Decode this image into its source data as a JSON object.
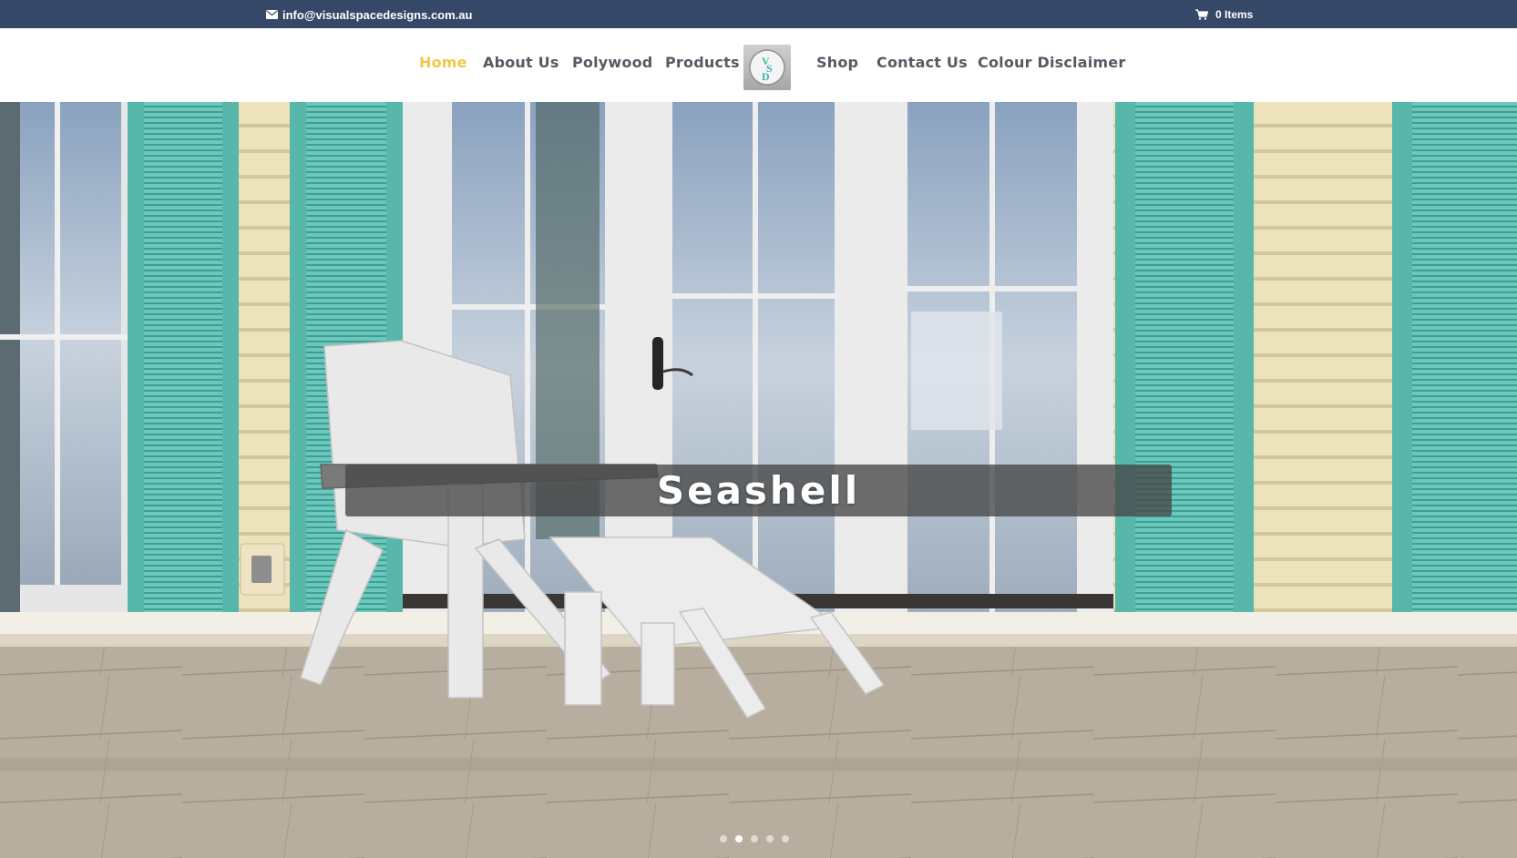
{
  "topbar": {
    "email": "info@visualspacedesigns.com.au",
    "cart_label": "0 Items"
  },
  "nav": {
    "items": [
      {
        "label": "Home",
        "active": true
      },
      {
        "label": "About Us"
      },
      {
        "label": "Polywood"
      },
      {
        "label": "Products"
      },
      {
        "label": "Shop"
      },
      {
        "label": "Contact Us"
      },
      {
        "label": "Colour Disclaimer"
      }
    ],
    "logo_text": "VSD",
    "active_color": "#f2c84b",
    "text_color": "#555a63"
  },
  "colors": {
    "topbar_bg": "#364868",
    "shutter": "#6cc7bd",
    "siding": "#ece2bb"
  },
  "hero": {
    "caption": "Seashell",
    "slides": 5,
    "active_slide": 2
  },
  "icons": {
    "email": "envelope-icon",
    "cart": "shopping-cart-icon"
  }
}
